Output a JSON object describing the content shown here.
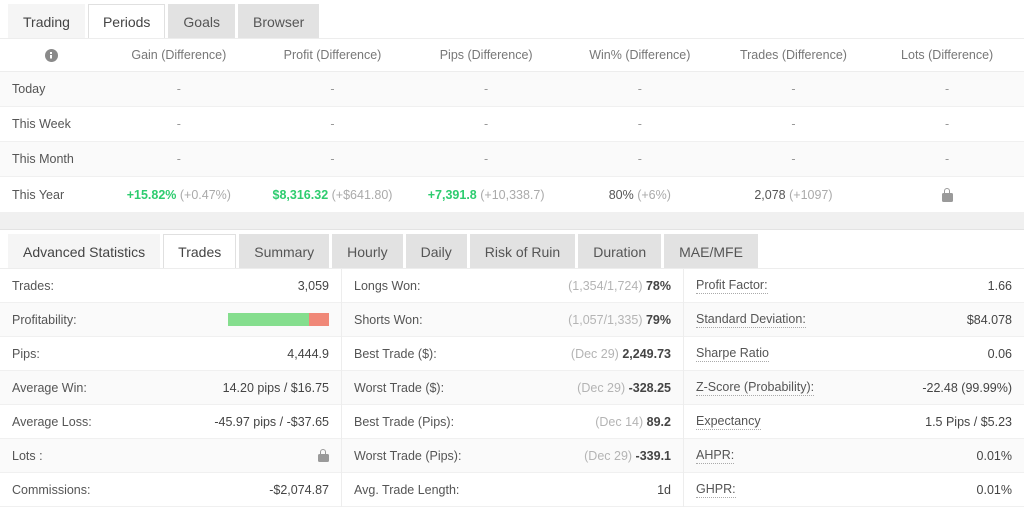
{
  "periods_panel": {
    "tabs": [
      {
        "label": "Trading",
        "state": "soft"
      },
      {
        "label": "Periods",
        "state": "active"
      },
      {
        "label": "Goals",
        "state": "inactive"
      },
      {
        "label": "Browser",
        "state": "inactive"
      }
    ],
    "columns": [
      {
        "label": "",
        "icon": "info-icon"
      },
      {
        "label": "Gain (Difference)"
      },
      {
        "label": "Profit (Difference)"
      },
      {
        "label": "Pips (Difference)"
      },
      {
        "label": "Win% (Difference)"
      },
      {
        "label": "Trades (Difference)"
      },
      {
        "label": "Lots (Difference)"
      }
    ],
    "rows": [
      {
        "label": "Today",
        "gain": {
          "main": "-",
          "diff": "",
          "style": "dash"
        },
        "profit": {
          "main": "-",
          "diff": "",
          "style": "dash"
        },
        "pips": {
          "main": "-",
          "diff": "",
          "style": "dash"
        },
        "win": {
          "main": "-",
          "diff": "",
          "style": "dash"
        },
        "trades": {
          "main": "-",
          "diff": "",
          "style": "dash"
        },
        "lots": {
          "main": "-",
          "diff": "",
          "style": "dash",
          "icon": ""
        }
      },
      {
        "label": "This Week",
        "gain": {
          "main": "-",
          "diff": "",
          "style": "dash"
        },
        "profit": {
          "main": "-",
          "diff": "",
          "style": "dash"
        },
        "pips": {
          "main": "-",
          "diff": "",
          "style": "dash"
        },
        "win": {
          "main": "-",
          "diff": "",
          "style": "dash"
        },
        "trades": {
          "main": "-",
          "diff": "",
          "style": "dash"
        },
        "lots": {
          "main": "-",
          "diff": "",
          "style": "dash",
          "icon": ""
        }
      },
      {
        "label": "This Month",
        "gain": {
          "main": "-",
          "diff": "",
          "style": "dash"
        },
        "profit": {
          "main": "-",
          "diff": "",
          "style": "dash"
        },
        "pips": {
          "main": "-",
          "diff": "",
          "style": "dash"
        },
        "win": {
          "main": "-",
          "diff": "",
          "style": "dash"
        },
        "trades": {
          "main": "-",
          "diff": "",
          "style": "dash"
        },
        "lots": {
          "main": "-",
          "diff": "",
          "style": "dash",
          "icon": ""
        }
      },
      {
        "label": "This Year",
        "gain": {
          "main": "+15.82%",
          "diff": "(+0.47%)",
          "style": "positive"
        },
        "profit": {
          "main": "$8,316.32",
          "diff": "(+$641.80)",
          "style": "positive"
        },
        "pips": {
          "main": "+7,391.8",
          "diff": "(+10,338.7)",
          "style": "positive"
        },
        "win": {
          "main": "80%",
          "diff": "(+6%)",
          "style": "neutral"
        },
        "trades": {
          "main": "2,078",
          "diff": "(+1097)",
          "style": "neutral"
        },
        "lots": {
          "main": "",
          "diff": "",
          "style": "locked",
          "icon": "lock-icon"
        }
      }
    ]
  },
  "stats_panel": {
    "tabs": [
      {
        "label": "Advanced Statistics",
        "state": "soft"
      },
      {
        "label": "Trades",
        "state": "active"
      },
      {
        "label": "Summary",
        "state": "inactive"
      },
      {
        "label": "Hourly",
        "state": "inactive"
      },
      {
        "label": "Daily",
        "state": "inactive"
      },
      {
        "label": "Risk of Ruin",
        "state": "inactive"
      },
      {
        "label": "Duration",
        "state": "inactive"
      },
      {
        "label": "MAE/MFE",
        "state": "inactive"
      }
    ],
    "columns": [
      {
        "rows": [
          {
            "label": "Trades:",
            "link": false,
            "prefix": "",
            "value": "3,059",
            "bold": false,
            "type": "text"
          },
          {
            "label": "Profitability:",
            "link": false,
            "prefix": "",
            "value": "",
            "bold": false,
            "type": "bar",
            "win_pct": 80,
            "loss_pct": 20
          },
          {
            "label": "Pips:",
            "link": false,
            "prefix": "",
            "value": "4,444.9",
            "bold": false,
            "type": "text"
          },
          {
            "label": "Average Win:",
            "link": false,
            "prefix": "",
            "value": "14.20 pips / $16.75",
            "bold": false,
            "type": "text"
          },
          {
            "label": "Average Loss:",
            "link": false,
            "prefix": "",
            "value": "-45.97 pips / -$37.65",
            "bold": false,
            "type": "text"
          },
          {
            "label": "Lots :",
            "link": false,
            "prefix": "",
            "value": "",
            "bold": false,
            "type": "lock"
          },
          {
            "label": "Commissions:",
            "link": false,
            "prefix": "",
            "value": "-$2,074.87",
            "bold": false,
            "type": "text"
          }
        ]
      },
      {
        "rows": [
          {
            "label": "Longs Won:",
            "link": false,
            "prefix": "(1,354/1,724)",
            "value": "78%",
            "bold": true,
            "type": "text"
          },
          {
            "label": "Shorts Won:",
            "link": false,
            "prefix": "(1,057/1,335)",
            "value": "79%",
            "bold": true,
            "type": "text"
          },
          {
            "label": "Best Trade ($):",
            "link": false,
            "prefix": "(Dec 29)",
            "value": "2,249.73",
            "bold": true,
            "type": "text"
          },
          {
            "label": "Worst Trade ($):",
            "link": false,
            "prefix": "(Dec 29)",
            "value": "-328.25",
            "bold": true,
            "type": "text"
          },
          {
            "label": "Best Trade (Pips):",
            "link": false,
            "prefix": "(Dec 14)",
            "value": "89.2",
            "bold": true,
            "type": "text"
          },
          {
            "label": "Worst Trade (Pips):",
            "link": false,
            "prefix": "(Dec 29)",
            "value": "-339.1",
            "bold": true,
            "type": "text"
          },
          {
            "label": "Avg. Trade Length:",
            "link": false,
            "prefix": "",
            "value": "1d",
            "bold": false,
            "type": "text"
          }
        ]
      },
      {
        "rows": [
          {
            "label": "Profit Factor:",
            "link": true,
            "prefix": "",
            "value": "1.66",
            "bold": false,
            "type": "text"
          },
          {
            "label": "Standard Deviation:",
            "link": true,
            "prefix": "",
            "value": "$84.078",
            "bold": false,
            "type": "text"
          },
          {
            "label": "Sharpe Ratio",
            "link": true,
            "prefix": "",
            "value": "0.06",
            "bold": false,
            "type": "text"
          },
          {
            "label": "Z-Score (Probability):",
            "link": true,
            "prefix": "",
            "value": "-22.48 (99.99%)",
            "bold": false,
            "type": "text"
          },
          {
            "label": "Expectancy",
            "link": true,
            "prefix": "",
            "value": "1.5 Pips / $5.23",
            "bold": false,
            "type": "text"
          },
          {
            "label": "AHPR:",
            "link": true,
            "prefix": "",
            "value": "0.01%",
            "bold": false,
            "type": "text"
          },
          {
            "label": "GHPR:",
            "link": true,
            "prefix": "",
            "value": "0.01%",
            "bold": false,
            "type": "text"
          }
        ]
      }
    ]
  },
  "colors": {
    "positive": "#2ecc6f",
    "muted": "#aaaaaa",
    "profit_bar_win": "#85de8e",
    "profit_bar_loss": "#f08878"
  }
}
